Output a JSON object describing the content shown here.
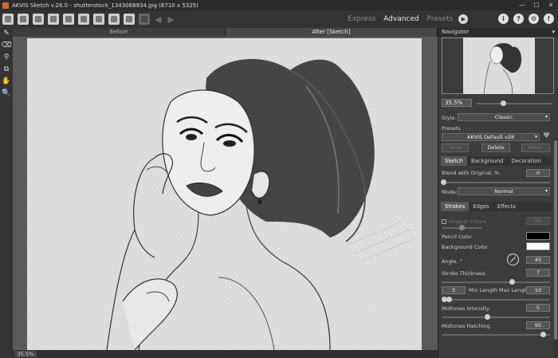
{
  "window": {
    "title": "AKVIS Sketch v.28.0 - shutterstock_1343068934.jpg (6710 x 5325)",
    "minimize": "—",
    "maximize": "☐",
    "close": "✕"
  },
  "toolbar": {
    "icons": [
      "open-icon",
      "save-icon",
      "export-icon",
      "print-icon",
      "batch-icon",
      "share-icon",
      "preferences-icon",
      "presets-icon",
      "apply-icon",
      "run-icon",
      "undo-icon",
      "redo-icon"
    ],
    "modes": [
      "Express",
      "Advanced",
      "Presets"
    ],
    "active_mode": "Advanced",
    "right_icons": [
      "i",
      "?",
      "⚙",
      "!"
    ]
  },
  "tools": [
    "✎",
    "⌫",
    "⚲",
    "⧉",
    "✋",
    "🔍"
  ],
  "view_tabs": {
    "before": "Before",
    "after": "After [Sketch]"
  },
  "status": {
    "zoom": "35.5%"
  },
  "navigator": {
    "title": "Navigator",
    "zoom": "35.5%"
  },
  "settings": {
    "style_label": "Style:",
    "style_value": "Classic",
    "presets_label": "Presets",
    "preset_value": "AKVIS Default v28",
    "save_label": "Save",
    "delete_label": "Delete",
    "reset_label": "Reset",
    "tabs": [
      "Sketch",
      "Background",
      "Decoration"
    ],
    "active_tab": "Sketch",
    "blend_label": "Blend with Original, %",
    "blend_value": "0",
    "mode_label": "Mode:",
    "mode_value": "Normal",
    "subtabs": [
      "Strokes",
      "Edges",
      "Effects"
    ],
    "active_subtab": "Strokes",
    "original_colors_label": "Original Colors",
    "original_colors_value": "50",
    "pencil_color_label": "Pencil Color",
    "pencil_color": "#000000",
    "background_color_label": "Background Color",
    "background_color": "#ffffff",
    "angle_label": "Angle, °",
    "angle_value": "45",
    "stroke_thickness_label": "Stroke Thickness",
    "stroke_thickness_value": "7",
    "min_length_value": "3",
    "min_length_label": "Min Length",
    "max_length_label": "Max Length",
    "max_length_value": "10",
    "midtones_intensity_label": "Midtones Intensity",
    "midtones_intensity_value": "5",
    "midtones_hatching_label": "Midtones Hatching",
    "midtones_hatching_value": "95"
  }
}
